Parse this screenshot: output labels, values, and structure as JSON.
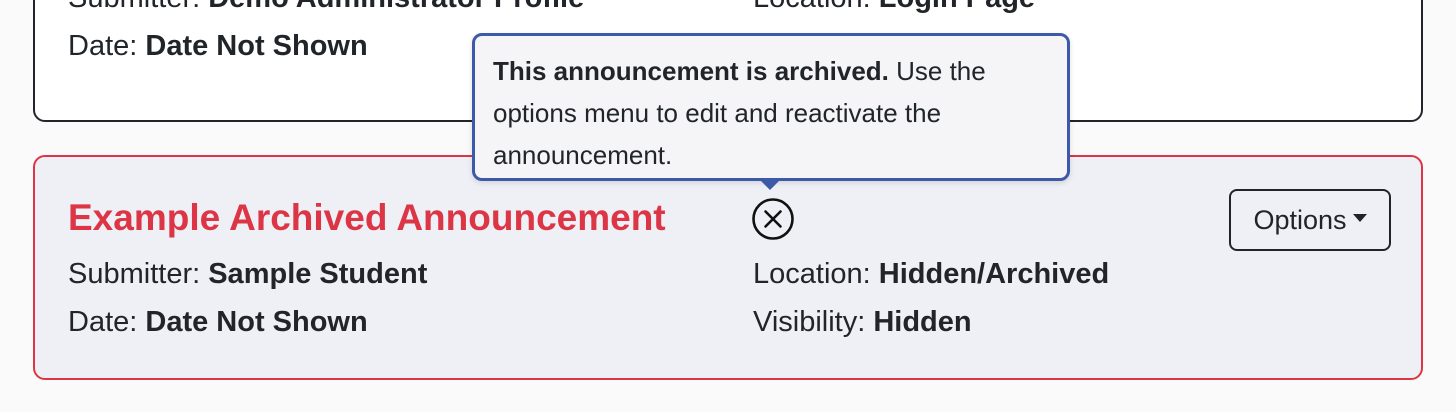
{
  "announcements": [
    {
      "submitter_label": "Submitter: ",
      "submitter": "Demo Administrator Profile",
      "location_label": "Location: ",
      "location": "Login Page",
      "date_label": "Date: ",
      "date": "Date Not Shown"
    },
    {
      "title": "Example Archived Announcement",
      "options_label": "Options",
      "submitter_label": "Submitter: ",
      "submitter": "Sample Student",
      "location_label": "Location: ",
      "location": "Hidden/Archived",
      "date_label": "Date: ",
      "date": "Date Not Shown",
      "visibility_label": "Visibility: ",
      "visibility": "Hidden",
      "status_icon": "circle-x-icon",
      "colors": {
        "title": "#dc3545",
        "border": "#dc3545",
        "background": "#eef0f5"
      }
    }
  ],
  "tooltip": {
    "bold": "This announcement is archived.",
    "text": " Use the options menu to edit and reactivate the announcement.",
    "border_color": "#3d5aa8"
  }
}
